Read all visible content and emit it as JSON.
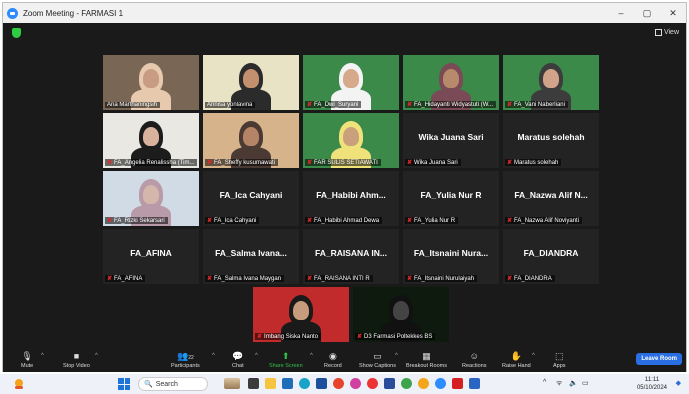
{
  "window": {
    "title": "Zoom Meeting - FARMASI 1",
    "controls": [
      "–",
      "▢",
      "✕"
    ]
  },
  "view_button": {
    "label": "View"
  },
  "participants": [
    {
      "name": "Ana Marthaningsih",
      "video": true,
      "skin": "#c89c82",
      "hijab": "#e7c9ae",
      "bg": "#7a6654"
    },
    {
      "name": "Annisa yonlavina",
      "video": true,
      "skin": "#c2906e",
      "hijab": "#2b2b2b",
      "bg": "#e8e3c4",
      "active": true
    },
    {
      "name": "FA_Dwi_Suryani",
      "video": true,
      "skin": "#d6a98a",
      "hijab": "#f3f3f3",
      "bg": "#3c8a4a"
    },
    {
      "name": "FA_Hidayanti Widyastuti (W...",
      "video": true,
      "skin": "#b88a6c",
      "hijab": "#7a4a56",
      "bg": "#3c8a4a"
    },
    {
      "name": "FA_Vani Naberliani",
      "video": true,
      "skin": "#d1a48a",
      "hijab": "#3c3c3c",
      "bg": "#3c8a4a"
    },
    {
      "name": "FA_Angelia Renalissha (Tim...",
      "video": true,
      "skin": "#d8b29c",
      "hijab": "#1c1c1c",
      "bg": "#e9e8e3"
    },
    {
      "name": "FA_Sheffy kusumawati",
      "video": true,
      "skin": "#b58466",
      "hijab": "#4b3a34",
      "bg": "#d7b38b"
    },
    {
      "name": "FAR SULIS SETIAWATI",
      "video": true,
      "skin": "#caa07c",
      "hijab": "#efe27a",
      "bg": "#3c8a4a"
    },
    {
      "name": "Wika Juana Sari",
      "display": "Wika Juana Sari",
      "video": false
    },
    {
      "name": "Maratus solehah",
      "display": "Maratus solehah",
      "video": false
    },
    {
      "name": "FA_Rizki Sekarsari",
      "video": true,
      "skin": "#d4b7aa",
      "hijab": "#b89aa8",
      "bg": "#d0dbe6"
    },
    {
      "name": "FA_Ica Cahyani",
      "display": "FA_Ica Cahyani",
      "video": false
    },
    {
      "name": "FA_Habibi Ahmad Dewa",
      "display": "FA_Habibi Ahm...",
      "video": false
    },
    {
      "name": "FA_Yulia Nur R",
      "display": "FA_Yulia Nur R",
      "video": false
    },
    {
      "name": "FA_Nazwa Alif Noviyanti",
      "display": "FA_Nazwa Alif N...",
      "video": false
    },
    {
      "name": "FA_AFINA",
      "display": "FA_AFINA",
      "video": false
    },
    {
      "name": "FA_Salma Ivana Maygan",
      "display": "FA_Salma Ivana...",
      "video": false
    },
    {
      "name": "FA_RAISANA INTI R",
      "display": "FA_RAISANA IN...",
      "video": false
    },
    {
      "name": "FA_Itsnaini Nurulaiyah",
      "display": "FA_Itsnaini Nura...",
      "video": false
    },
    {
      "name": "FA_DIANDRA",
      "display": "FA_DIANDRA",
      "video": false
    },
    {
      "name": "Imbang Siska Nanto",
      "video": true,
      "skin": "#c79c7c",
      "hijab": "#1a1a1a",
      "bg": "#c22b2b"
    },
    {
      "name": "D3 Farmasi Poltekkes BS",
      "video": true,
      "skin": "#444",
      "hijab": "#111",
      "bg": "#0e1a0e"
    }
  ],
  "toolbar": {
    "mute": "Mute",
    "stop_video": "Stop Video",
    "participants": "Participants",
    "participants_count": "22",
    "chat": "Chat",
    "share_screen": "Share Screen",
    "record": "Record",
    "show_captions": "Show Captions",
    "breakout_rooms": "Breakout Rooms",
    "reactions": "Reactions",
    "raise_hand": "Raise Hand",
    "apps": "Apps",
    "leave": "Leave Room"
  },
  "taskbar": {
    "search_placeholder": "Search",
    "time": "11:11",
    "date": "05/10/2024"
  },
  "colors": {
    "zoom_blue": "#2d8cff",
    "active_speaker": "#7bd33a",
    "leave_button": "#2a6ee3",
    "share_green": "#33c24a",
    "muted_red": "#e02828"
  }
}
